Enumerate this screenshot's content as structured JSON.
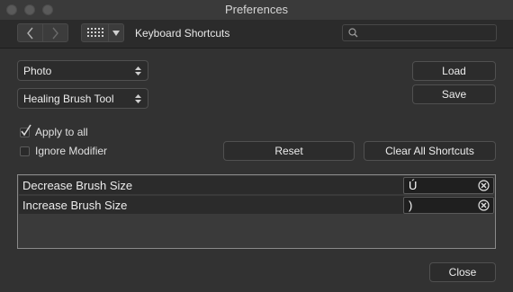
{
  "window": {
    "title": "Preferences"
  },
  "toolbar": {
    "back_icon": "chevron-left-icon",
    "forward_icon": "chevron-right-icon",
    "grid_icon": "grid-icon",
    "dropdown_icon": "chevron-down-icon",
    "section_title": "Keyboard Shortcuts",
    "search": {
      "placeholder": "",
      "value": "",
      "icon": "search-icon"
    }
  },
  "controls": {
    "persona_select": "Photo",
    "tool_select": "Healing Brush Tool",
    "load_label": "Load",
    "save_label": "Save",
    "apply_to_all": {
      "label": "Apply to all",
      "checked": true
    },
    "ignore_modifier": {
      "label": "Ignore Modifier",
      "checked": false
    },
    "reset_label": "Reset",
    "clear_all_label": "Clear All Shortcuts"
  },
  "shortcuts": [
    {
      "label": "Decrease Brush Size",
      "key": "Ú"
    },
    {
      "label": "Increase Brush Size",
      "key": ")"
    }
  ],
  "footer": {
    "close_label": "Close"
  },
  "colors": {
    "background": "#323232",
    "toolbar": "#2b2b2b",
    "panel_border": "#8a8a8a"
  }
}
